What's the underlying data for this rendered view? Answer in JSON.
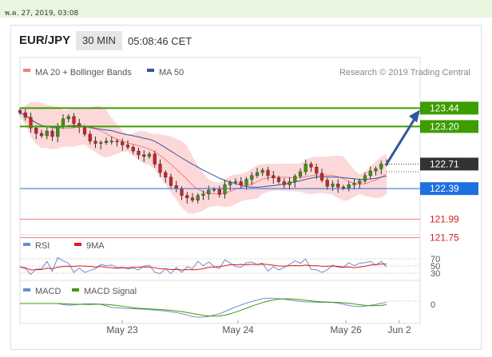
{
  "datetime": "พ.ค. 27, 2019, 03:08",
  "header": {
    "pair": "EUR/JPY",
    "timeframe": "30 MIN",
    "time": "05:08:46 CET"
  },
  "legend": {
    "ma20": "MA 20 + Bollinger Bands",
    "ma50": "MA 50",
    "credit": "Research © 2019 Trading Central",
    "rsi": "RSI",
    "nine_ma": "9MA",
    "macd": "MACD",
    "macd_signal": "MACD Signal"
  },
  "colors": {
    "up": "#3d9c00",
    "down": "#e01c1c",
    "current": "#333333",
    "pivot": "#1e6fe0",
    "ma20": "#f08080",
    "ma50": "#31589c",
    "band": "#fdd8d8",
    "arrow": "#31589c"
  },
  "chart_data": {
    "type": "line",
    "x_ticks": [
      "May 23",
      "May 24",
      "May 26",
      "Jun 2"
    ],
    "price_range": [
      121.6,
      123.6
    ],
    "close": [
      123.38,
      123.32,
      123.18,
      123.11,
      123.08,
      123.14,
      123.07,
      123.2,
      123.3,
      123.33,
      123.24,
      123.19,
      123.1,
      123.01,
      122.98,
      122.99,
      123.01,
      123.01,
      123.0,
      122.96,
      122.93,
      122.88,
      122.83,
      122.81,
      122.84,
      122.71,
      122.6,
      122.54,
      122.43,
      122.39,
      122.3,
      122.27,
      122.24,
      122.3,
      122.32,
      122.37,
      122.38,
      122.32,
      122.44,
      122.47,
      122.48,
      122.44,
      122.51,
      122.56,
      122.6,
      122.63,
      122.56,
      122.53,
      122.48,
      122.44,
      122.48,
      122.55,
      122.61,
      122.71,
      122.67,
      122.59,
      122.5,
      122.42,
      122.45,
      122.41,
      122.4,
      122.44,
      122.46,
      122.49,
      122.56,
      122.62,
      122.65,
      122.71,
      122.71
    ],
    "levels": [
      {
        "value": "123.44",
        "kind": "resistance"
      },
      {
        "value": "123.20",
        "kind": "resistance"
      },
      {
        "value": "122.71",
        "kind": "current"
      },
      {
        "value": "122.39",
        "kind": "pivot"
      },
      {
        "value": "121.99",
        "kind": "support"
      },
      {
        "value": "121.75",
        "kind": "support"
      }
    ],
    "rsi_levels": [
      "70",
      "50",
      "30"
    ],
    "macd_levels": [
      "0"
    ]
  }
}
